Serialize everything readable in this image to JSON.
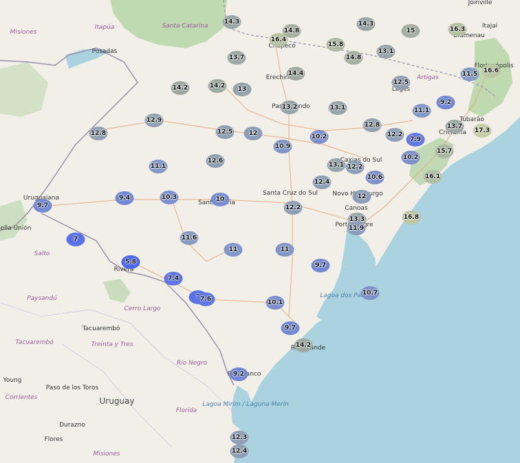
{
  "palette": {
    "land": "#f2efe9",
    "sea": "#aad3df",
    "forest": "#add19e",
    "road": "#e6a87a",
    "border": "#9b8fa8"
  },
  "map_labels": {
    "places": [
      "Joinville",
      "Itajaí",
      "Posadas",
      "Chapecó",
      "Erechim",
      "Lages",
      "Passo Fundo",
      "Florianópolis",
      "Blumenau",
      "Tubarão",
      "Criciúma",
      "Santa Cruz do Sul",
      "Novo Hamburgo",
      "Canoas",
      "Porto Alegre",
      "Santa Maria",
      "Rio Grande",
      "Rivera",
      "Uruguaiana",
      "Bella Unión",
      "Tacuarembó",
      "Young",
      "Paso de los Toros",
      "Durazno",
      "Flores",
      "Rio Branco",
      "Caxias do Sul"
    ],
    "regions": [
      "Misiones",
      "Itapúa",
      "Santa Catarina",
      "Artigas",
      "Salto",
      "Paysandú",
      "Tacuarembó",
      "Cerro Largo",
      "Treinta y Tres",
      "Rio Negro",
      "Florida",
      "Corrientes",
      "Misiones"
    ],
    "country": "Uruguay",
    "water": [
      "Lagoa dos Patos",
      "Lagoa Mirim / Laguna Merín"
    ]
  },
  "stations": [
    {
      "v": "14.3",
      "bg": "#9aa7a6"
    },
    {
      "v": "14.8",
      "bg": "#a6b0a0"
    },
    {
      "v": "16.4",
      "bg": "#b9c2a3"
    },
    {
      "v": "14.3",
      "bg": "#9aa7a6"
    },
    {
      "v": "15",
      "bg": "#a4af9f"
    },
    {
      "v": "16.3",
      "bg": "#b6c0a2"
    },
    {
      "v": "15.8",
      "bg": "#aeb8a2"
    },
    {
      "v": "14.8",
      "bg": "#a6b0a0"
    },
    {
      "v": "13.1",
      "bg": "#96a4ab"
    },
    {
      "v": "13.7",
      "bg": "#9ca8a6"
    },
    {
      "v": "14.4",
      "bg": "#a0ab9f"
    },
    {
      "v": "14.2",
      "bg": "#9eaaa1"
    },
    {
      "v": "14.2",
      "bg": "#9eaaa1"
    },
    {
      "v": "13",
      "bg": "#95a3ad"
    },
    {
      "v": "12.5",
      "bg": "#8fa0b4"
    },
    {
      "v": "11.5",
      "bg": "#869ac3"
    },
    {
      "v": "16.6",
      "bg": "#bbc5a2"
    },
    {
      "v": "13.2",
      "bg": "#97a5aa"
    },
    {
      "v": "13.1",
      "bg": "#96a4ab"
    },
    {
      "v": "11.1",
      "bg": "#8497c7"
    },
    {
      "v": "9.2",
      "bg": "#7187d6"
    },
    {
      "v": "12.9",
      "bg": "#93a2b0"
    },
    {
      "v": "12.8",
      "bg": "#92a1b1"
    },
    {
      "v": "12.8",
      "bg": "#92a1b1"
    },
    {
      "v": "13.7",
      "bg": "#9ca8a6"
    },
    {
      "v": "17.3",
      "bg": "#c6cda5"
    },
    {
      "v": "12.5",
      "bg": "#8fa0b4"
    },
    {
      "v": "12",
      "bg": "#8b9db8"
    },
    {
      "v": "10.9",
      "bg": "#7f93c9"
    },
    {
      "v": "10.2",
      "bg": "#7b8fcd"
    },
    {
      "v": "12.2",
      "bg": "#8d9fb7"
    },
    {
      "v": "7.9",
      "bg": "#6179e0"
    },
    {
      "v": "15.7",
      "bg": "#acb7a1"
    },
    {
      "v": "10.2",
      "bg": "#7b8fcd"
    },
    {
      "v": "12.6",
      "bg": "#90a0b3"
    },
    {
      "v": "11.1",
      "bg": "#8497c7"
    },
    {
      "v": "13.1",
      "bg": "#96a4ab"
    },
    {
      "v": "12.2",
      "bg": "#8d9fb7"
    },
    {
      "v": "10.6",
      "bg": "#7d91cb"
    },
    {
      "v": "16.1",
      "bg": "#b3bda2"
    },
    {
      "v": "12.4",
      "bg": "#8e9fb5"
    },
    {
      "v": "9.7",
      "bg": "#7489d3"
    },
    {
      "v": "9.4",
      "bg": "#7287d5"
    },
    {
      "v": "10.3",
      "bg": "#7c90cc"
    },
    {
      "v": "10",
      "bg": "#798ece"
    },
    {
      "v": "12",
      "bg": "#8b9db8"
    },
    {
      "v": "12.2",
      "bg": "#8d9fb7"
    },
    {
      "v": "13.3",
      "bg": "#98a5aa"
    },
    {
      "v": "11.9",
      "bg": "#8a9cba"
    },
    {
      "v": "16.8",
      "bg": "#bec7a2"
    },
    {
      "v": "7",
      "bg": "#5a72e6"
    },
    {
      "v": "11.6",
      "bg": "#889ac0"
    },
    {
      "v": "11",
      "bg": "#8396c8"
    },
    {
      "v": "11",
      "bg": "#8396c8"
    },
    {
      "v": "5.8",
      "bg": "#4c66ee"
    },
    {
      "v": "9.7",
      "bg": "#7489d3"
    },
    {
      "v": "7.4",
      "bg": "#5d75e3"
    },
    {
      "v": "7",
      "bg": "#5a72e6"
    },
    {
      "v": "7.6",
      "bg": "#5f77e2"
    },
    {
      "v": "10.7",
      "bg": "#7e92ca"
    },
    {
      "v": "10.1",
      "bg": "#7a8ecd"
    },
    {
      "v": "9.7",
      "bg": "#7489d3"
    },
    {
      "v": "14.2",
      "bg": "#9eaaa1"
    },
    {
      "v": "9.2",
      "bg": "#7187d6"
    },
    {
      "v": "12.3",
      "bg": "#8e9fb6"
    },
    {
      "v": "12.4",
      "bg": "#8e9fb5"
    }
  ]
}
